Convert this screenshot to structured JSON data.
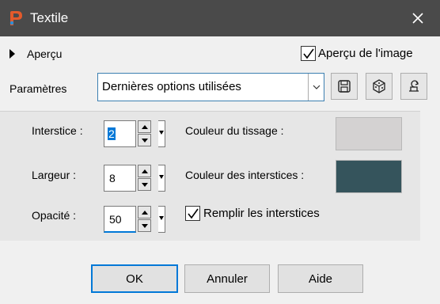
{
  "window": {
    "title": "Textile"
  },
  "preview_row": {
    "expander_label": "Aperçu",
    "preview_checkbox_label": "Aperçu de l'image",
    "preview_checked": true
  },
  "presets": {
    "label": "Paramètres",
    "selected": "Dernières options utilisées",
    "save_icon": "floppy-disk-icon",
    "random_icon": "dice-icon",
    "reset_icon": "reset-icon"
  },
  "settings": {
    "gap_label": "Interstice :",
    "gap_value": "2",
    "width_label": "Largeur :",
    "width_value": "8",
    "opacity_label": "Opacité :",
    "opacity_value": "50",
    "weave_color_label": "Couleur du tissage :",
    "weave_color": "#d4d2d2",
    "gap_color_label": "Couleur des interstices :",
    "gap_color": "#35545c",
    "fill_gaps_label": "Remplir les interstices",
    "fill_gaps_checked": true
  },
  "buttons": {
    "ok": "OK",
    "cancel": "Annuler",
    "help": "Aide"
  },
  "colors": {
    "titlebar": "#4a4a4a",
    "focus_accent": "#0078d7"
  }
}
